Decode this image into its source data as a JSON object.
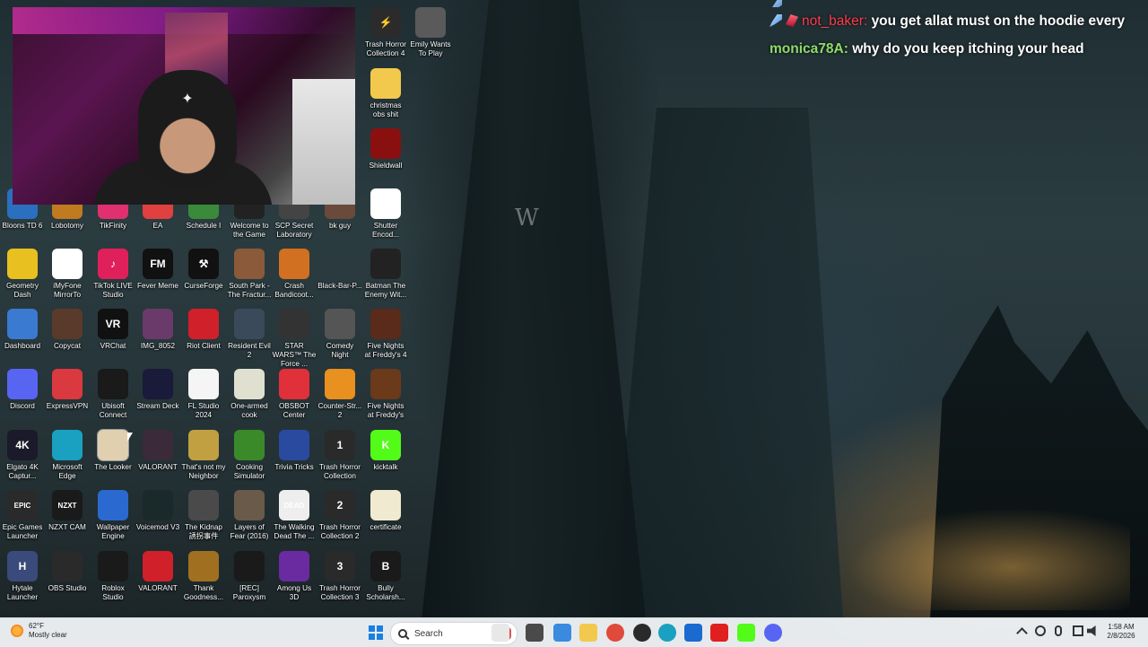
{
  "chat": {
    "messages": [
      {
        "user": "",
        "text": "",
        "partial": true
      },
      {
        "user": "not_baker:",
        "text": "you get allat must on the hoodie every"
      },
      {
        "user": "monica78A:",
        "text": "why do you keep itching your head"
      }
    ]
  },
  "desktop": {
    "icons": [
      {
        "label": "Trash Horror Collection 4",
        "icon": "lightning-icon",
        "color": "#2b2b2b",
        "glyph": "⚡"
      },
      {
        "label": "Emily Wants To Play",
        "icon": "face-icon",
        "color": "#5a5a5a",
        "glyph": ""
      },
      {
        "label": "christmas obs shit",
        "icon": "folder-icon",
        "color": "#f2c94c",
        "glyph": ""
      },
      {
        "label": "Shieldwall",
        "icon": "shield-icon",
        "color": "#8a1010",
        "glyph": ""
      },
      {
        "label": "Shutter Encod...",
        "icon": "aperture-icon",
        "color": "#ffffff",
        "glyph": ""
      },
      {
        "label": "Bloons TD 6",
        "icon": "monkey-icon",
        "color": "#2a6fc0",
        "glyph": ""
      },
      {
        "label": "Lobotomy",
        "icon": "game-icon",
        "color": "#c07a20",
        "glyph": ""
      },
      {
        "label": "TikFinity",
        "icon": "tikfinity-icon",
        "color": "#e03070",
        "glyph": ""
      },
      {
        "label": "EA",
        "icon": "ea-icon",
        "color": "#e04040",
        "glyph": ""
      },
      {
        "label": "Schedule I",
        "icon": "game-icon",
        "color": "#3a8a3a",
        "glyph": ""
      },
      {
        "label": "Welcome to the Game",
        "icon": "skull-icon",
        "color": "#222222",
        "glyph": ""
      },
      {
        "label": "SCP Secret Laboratory",
        "icon": "scp-icon",
        "color": "#444444",
        "glyph": ""
      },
      {
        "label": "bk guy",
        "icon": "image-icon",
        "color": "#6a4a3a",
        "glyph": ""
      },
      {
        "label": "Geometry Dash",
        "icon": "geometry-dash-icon",
        "color": "#e8c020",
        "glyph": ""
      },
      {
        "label": "iMyFone MirrorTo",
        "icon": "mirror-icon",
        "color": "#ffffff",
        "glyph": ""
      },
      {
        "label": "TikTok LIVE Studio",
        "icon": "tiktok-icon",
        "color": "#e0205a",
        "glyph": "♪"
      },
      {
        "label": "Fever Meme",
        "icon": "fm-icon",
        "color": "#111111",
        "glyph": "FM"
      },
      {
        "label": "CurseForge",
        "icon": "curseforge-icon",
        "color": "#111111",
        "glyph": "⚒"
      },
      {
        "label": "South Park - The Fractur...",
        "icon": "game-icon",
        "color": "#8a5a3a",
        "glyph": ""
      },
      {
        "label": "Crash Bandicoot...",
        "icon": "crash-icon",
        "color": "#d07020",
        "glyph": ""
      },
      {
        "label": "Black-Bar-P...",
        "icon": "blank-icon",
        "color": "transparent",
        "glyph": ""
      },
      {
        "label": "Batman The Enemy Wit...",
        "icon": "batman-icon",
        "color": "#222222",
        "glyph": ""
      },
      {
        "label": "Dashboard",
        "icon": "shield-check-icon",
        "color": "#3a7ad0",
        "glyph": ""
      },
      {
        "label": "Copycat",
        "icon": "copycat-icon",
        "color": "#5a3a2a",
        "glyph": ""
      },
      {
        "label": "VRChat",
        "icon": "vrchat-icon",
        "color": "#111111",
        "glyph": "VR"
      },
      {
        "label": "IMG_8052",
        "icon": "image-icon",
        "color": "#6a3a6a",
        "glyph": ""
      },
      {
        "label": "Riot Client",
        "icon": "riot-icon",
        "color": "#d0202a",
        "glyph": ""
      },
      {
        "label": "Resident Evil 2",
        "icon": "game-icon",
        "color": "#3a4a5a",
        "glyph": ""
      },
      {
        "label": "STAR WARS™ The Force ...",
        "icon": "game-icon",
        "color": "#333333",
        "glyph": ""
      },
      {
        "label": "Comedy Night",
        "icon": "microphone-icon",
        "color": "#555555",
        "glyph": ""
      },
      {
        "label": "Five Nights at Freddy's 4",
        "icon": "freddy-icon",
        "color": "#5a2a1a",
        "glyph": ""
      },
      {
        "label": "Discord",
        "icon": "discord-icon",
        "color": "#5865f2",
        "glyph": ""
      },
      {
        "label": "ExpressVPN",
        "icon": "vpn-icon",
        "color": "#da3940",
        "glyph": ""
      },
      {
        "label": "Ubisoft Connect",
        "icon": "ubisoft-icon",
        "color": "#1a1a1a",
        "glyph": ""
      },
      {
        "label": "Stream Deck",
        "icon": "stream-deck-icon",
        "color": "#1a1a3a",
        "glyph": ""
      },
      {
        "label": "FL Studio 2024",
        "icon": "fl-studio-icon",
        "color": "#f5f5f5",
        "glyph": ""
      },
      {
        "label": "One-armed cook",
        "icon": "game-icon",
        "color": "#e0e0d0",
        "glyph": ""
      },
      {
        "label": "OBSBOT Center",
        "icon": "obsbot-icon",
        "color": "#e0303a",
        "glyph": ""
      },
      {
        "label": "Counter-Str... 2",
        "icon": "counter-strike-icon",
        "color": "#e89020",
        "glyph": ""
      },
      {
        "label": "Five Nights at Freddy's",
        "icon": "freddy-icon",
        "color": "#6a3a1a",
        "glyph": ""
      },
      {
        "label": "Elgato 4K Captur...",
        "icon": "elgato-icon",
        "color": "#1a1a2a",
        "glyph": "4K"
      },
      {
        "label": "Microsoft Edge",
        "icon": "edge-icon",
        "color": "#1aa0c0",
        "glyph": ""
      },
      {
        "label": "The Looker",
        "icon": "looker-icon",
        "color": "#e0d0b0",
        "glyph": ""
      },
      {
        "label": "VALORANT",
        "icon": "valorant-icon",
        "color": "#3a2a3a",
        "glyph": ""
      },
      {
        "label": "That's not my Neighbor",
        "icon": "game-icon",
        "color": "#c0a040",
        "glyph": ""
      },
      {
        "label": "Cooking Simulator",
        "icon": "cooking-icon",
        "color": "#3a8a2a",
        "glyph": ""
      },
      {
        "label": "Trivia Tricks",
        "icon": "hat-icon",
        "color": "#2a4aa0",
        "glyph": ""
      },
      {
        "label": "Trash Horror Collection",
        "icon": "game-icon",
        "color": "#2a2a2a",
        "glyph": "1"
      },
      {
        "label": "kicktalk",
        "icon": "kick-icon",
        "color": "#53fc18",
        "glyph": "K"
      },
      {
        "label": "Epic Games Launcher",
        "icon": "epic-icon",
        "color": "#2a2a2a",
        "glyph": "EPIC"
      },
      {
        "label": "NZXT CAM",
        "icon": "nzxt-icon",
        "color": "#1a1a1a",
        "glyph": "NZXT"
      },
      {
        "label": "Wallpaper Engine",
        "icon": "wallpaper-engine-icon",
        "color": "#2a6ad0",
        "glyph": ""
      },
      {
        "label": "Voicemod V3",
        "icon": "voicemod-icon",
        "color": "#1a2a2a",
        "glyph": ""
      },
      {
        "label": "The Kidnap 誘拐事件",
        "icon": "game-icon",
        "color": "#4a4a4a",
        "glyph": ""
      },
      {
        "label": "Layers of Fear (2016)",
        "icon": "game-icon",
        "color": "#6a5a4a",
        "glyph": ""
      },
      {
        "label": "The Walking Dead The ...",
        "icon": "walking-dead-icon",
        "color": "#eeeeee",
        "glyph": "DEAD"
      },
      {
        "label": "Trash Horror Collection 2",
        "icon": "game-icon",
        "color": "#2a2a2a",
        "glyph": "2"
      },
      {
        "label": "certificate",
        "icon": "certificate-icon",
        "color": "#f0ead0",
        "glyph": ""
      },
      {
        "label": "Hytale Launcher",
        "icon": "hytale-icon",
        "color": "#3a4a7a",
        "glyph": "H"
      },
      {
        "label": "OBS Studio",
        "icon": "obs-icon",
        "color": "#2a2a2a",
        "glyph": ""
      },
      {
        "label": "Roblox Studio",
        "icon": "roblox-icon",
        "color": "#1a1a1a",
        "glyph": ""
      },
      {
        "label": "VALORANT",
        "icon": "riot-icon",
        "color": "#d0202a",
        "glyph": ""
      },
      {
        "label": "Thank Goodness...",
        "icon": "game-icon",
        "color": "#a07020",
        "glyph": ""
      },
      {
        "label": "[REC] Paroxysm",
        "icon": "record-icon",
        "color": "#1a1a1a",
        "glyph": ""
      },
      {
        "label": "Among Us 3D",
        "icon": "among-us-icon",
        "color": "#6a2aa0",
        "glyph": ""
      },
      {
        "label": "Trash Horror Collection 3",
        "icon": "game-icon",
        "color": "#2a2a2a",
        "glyph": "3"
      },
      {
        "label": "Bully Scholarsh...",
        "icon": "bully-icon",
        "color": "#1a1a1a",
        "glyph": "B"
      }
    ]
  },
  "taskbar": {
    "weather_temp": "62°F",
    "weather_desc": "Mostly clear",
    "search_placeholder": "Search",
    "time": "1:58 AM",
    "date": "2/8/2026",
    "apps": [
      {
        "icon": "widgets-icon",
        "color": "#e8e8e8"
      },
      {
        "icon": "file-explorer-icon",
        "color": "#4a4a4a"
      },
      {
        "icon": "copilot-icon",
        "color": "#3a8ae0"
      },
      {
        "icon": "folder-icon",
        "color": "#f2c94c"
      },
      {
        "icon": "chrome-icon",
        "color": "#e04a3a"
      },
      {
        "icon": "obs-icon",
        "color": "#2a2a2a"
      },
      {
        "icon": "edge-icon",
        "color": "#1aa0c0"
      },
      {
        "icon": "store-icon",
        "color": "#1a6ad0"
      },
      {
        "icon": "youtube-icon",
        "color": "#e02020"
      },
      {
        "icon": "kick-icon",
        "color": "#53fc18"
      },
      {
        "icon": "discord-icon",
        "color": "#5865f2"
      }
    ]
  }
}
